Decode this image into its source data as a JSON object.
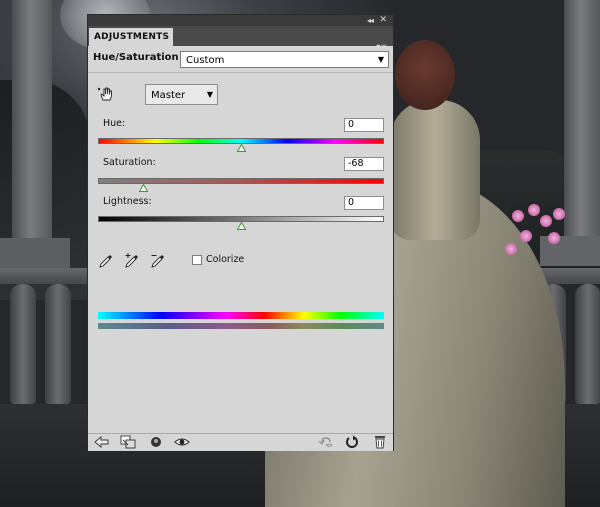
{
  "panel": {
    "tab_label": "ADJUSTMENTS",
    "collapse_glyph": "◂◂",
    "close_glyph": "✕",
    "menu_glyph": "▾≡"
  },
  "header": {
    "title": "Hue/Saturation",
    "preset_value": "Custom",
    "preset_arrow": "▼"
  },
  "channel": {
    "value": "Master",
    "arrow": "▼"
  },
  "sliders": {
    "hue": {
      "label": "Hue:",
      "value": "0"
    },
    "saturation": {
      "label": "Saturation:",
      "value": "-68"
    },
    "lightness": {
      "label": "Lightness:",
      "value": "0"
    }
  },
  "slider_levels": {
    "hue": 0.5,
    "saturation": 0.16,
    "lightness": 0.5
  },
  "colorize": {
    "label": "Colorize",
    "checked": false
  },
  "icons": {
    "hand": "targeted-adjustment-hand-icon",
    "eyedroppers": [
      "eyedropper-icon",
      "eyedropper-plus-icon",
      "eyedropper-minus-icon"
    ],
    "footer_left": [
      "back-arrow-icon",
      "clip-to-layer-icon",
      "visibility-circle-icon",
      "eye-icon"
    ],
    "footer_right": [
      "view-previous-state-icon",
      "reset-icon",
      "trash-icon"
    ]
  },
  "colors": {
    "panel_bg": "#d6d6d6",
    "thumb_green": "#2f9a2f"
  }
}
